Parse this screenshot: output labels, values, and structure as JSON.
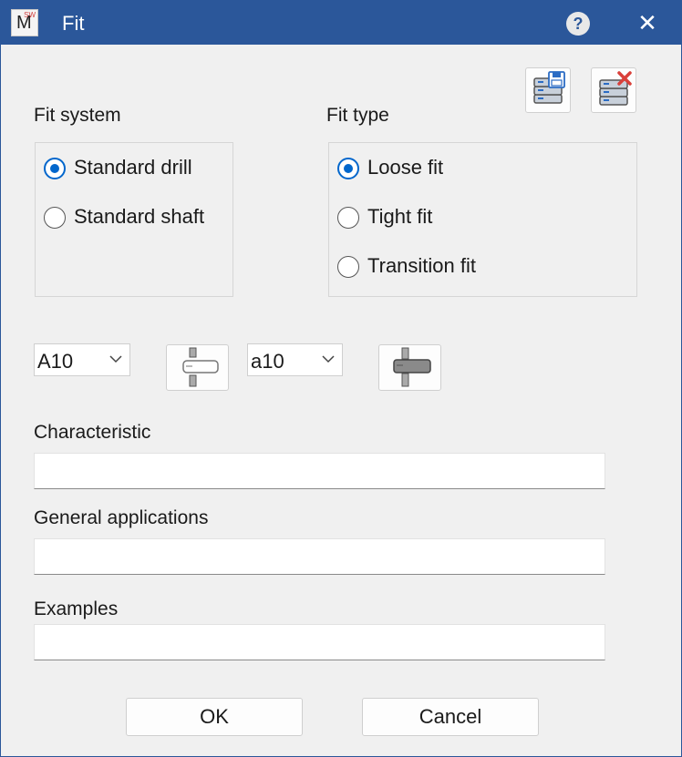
{
  "window": {
    "title": "Fit",
    "app_icon_letter": "M",
    "app_icon_mark": "SW"
  },
  "titlebar": {
    "help_label": "?",
    "close_label": "✕"
  },
  "toolbar": {
    "save_icon": "database-save-icon",
    "delete_icon": "database-delete-icon"
  },
  "fit_system": {
    "heading": "Fit system",
    "options": [
      {
        "label": "Standard drill",
        "checked": true
      },
      {
        "label": "Standard shaft",
        "checked": false
      }
    ]
  },
  "fit_type": {
    "heading": "Fit type",
    "options": [
      {
        "label": "Loose fit",
        "checked": true
      },
      {
        "label": "Tight fit",
        "checked": false
      },
      {
        "label": "Transition fit",
        "checked": false
      }
    ]
  },
  "tolerance": {
    "hole_value": "A10",
    "shaft_value": "a10"
  },
  "fields": {
    "characteristic_label": "Characteristic",
    "characteristic_value": "",
    "general_label": "General applications",
    "general_value": "",
    "examples_label": "Examples",
    "examples_value": ""
  },
  "buttons": {
    "ok": "OK",
    "cancel": "Cancel"
  },
  "colors": {
    "titlebar": "#2b579a",
    "accent": "#0066cc",
    "background": "#f0f0f0"
  }
}
